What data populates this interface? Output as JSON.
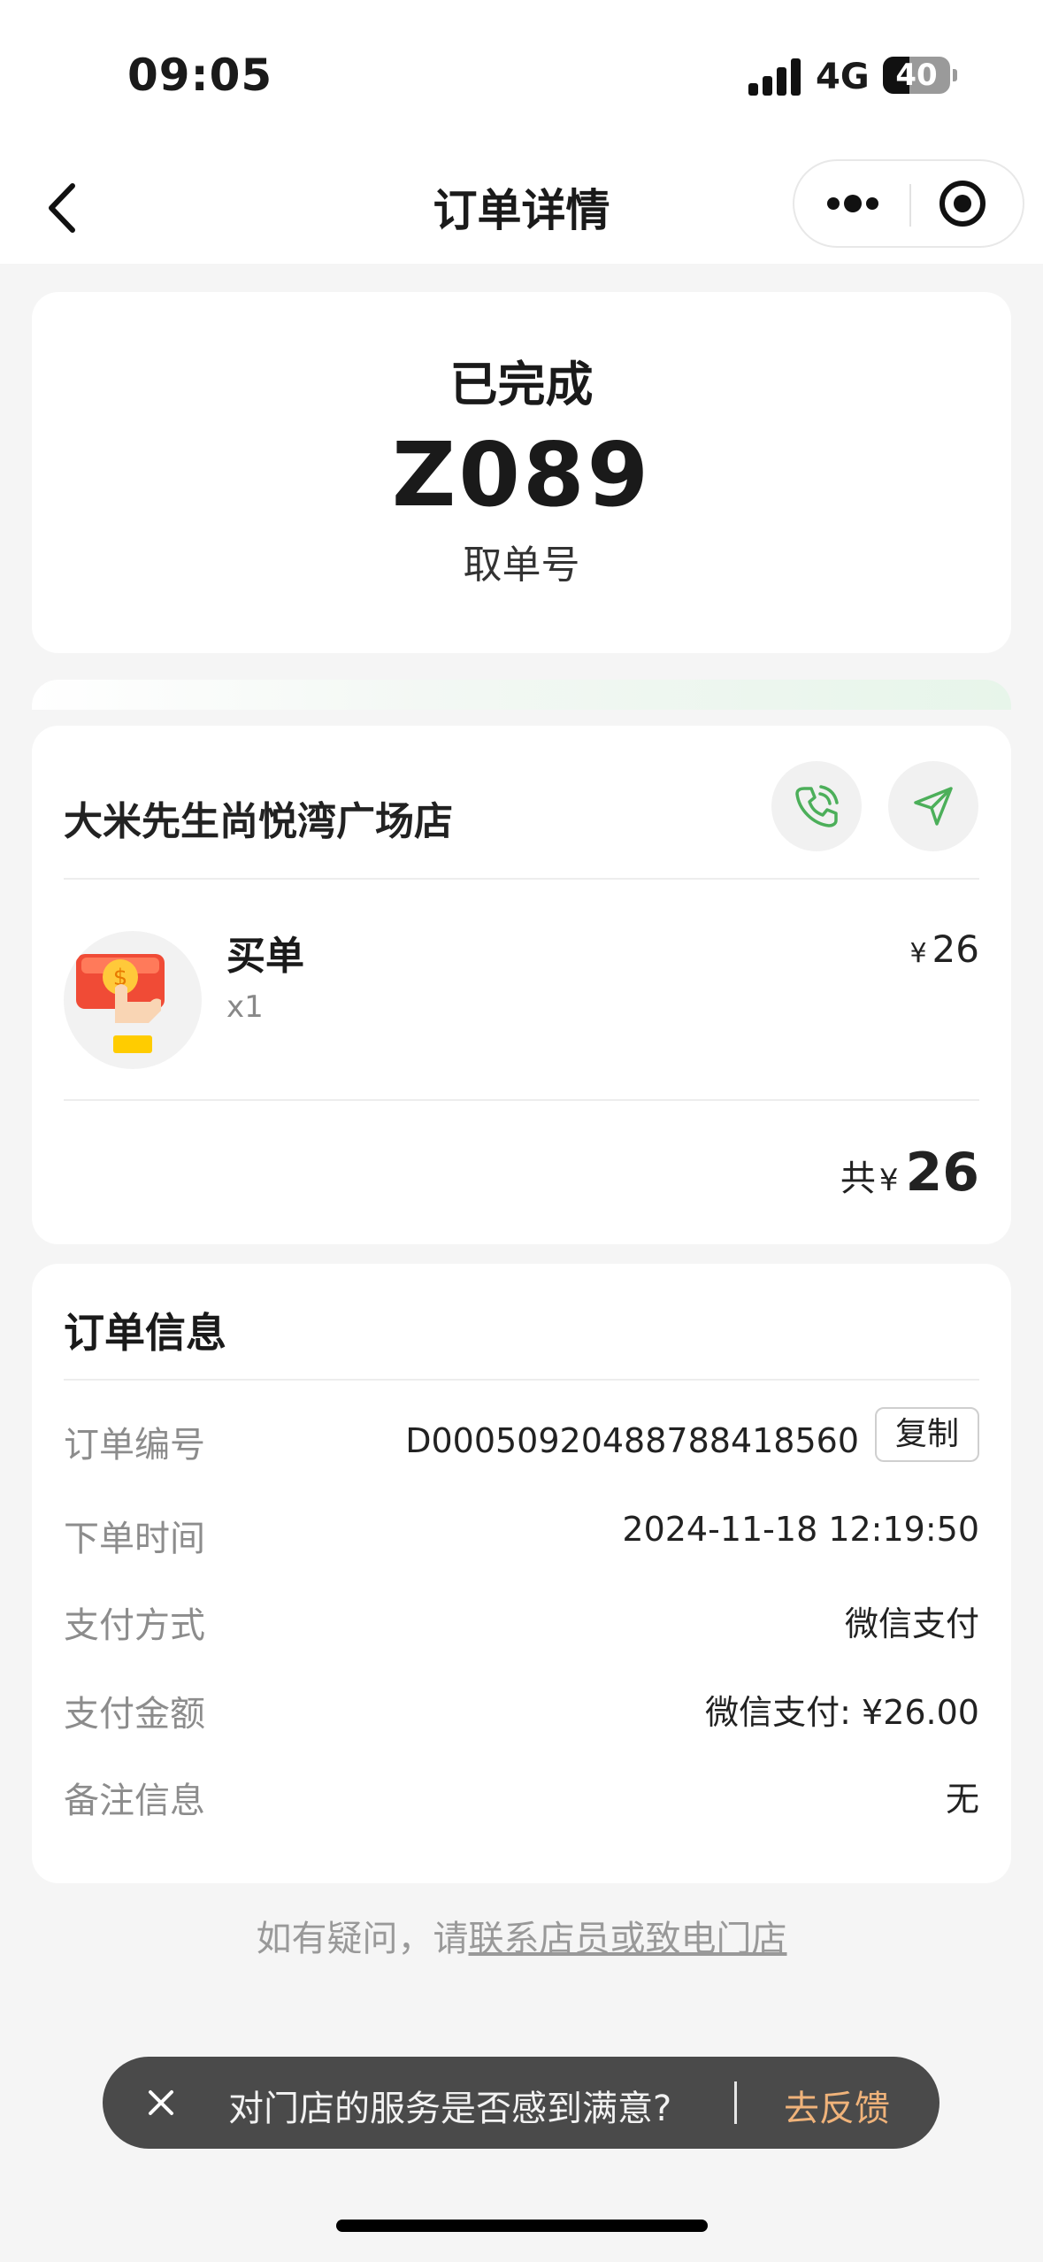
{
  "status_bar": {
    "time": "09:05",
    "network": "4G",
    "battery": "40",
    "battery_level": 0.4
  },
  "nav": {
    "title": "订单详情",
    "icons": [
      "chevron-left-icon",
      "more-dots-icon",
      "target-icon"
    ]
  },
  "order_status": {
    "status": "已完成",
    "pickup_code": "Z089",
    "pickup_label": "取单号"
  },
  "store": {
    "name": "大米先生尚悦湾广场店",
    "icons": [
      "phone-icon",
      "navigation-icon"
    ],
    "items": [
      {
        "name": "买单",
        "qty": "x1",
        "currency": "¥",
        "price": "26"
      }
    ],
    "total_label": "共",
    "total_currency": "¥",
    "total_amount": "26"
  },
  "order_info": {
    "title": "订单信息",
    "order_no_label": "订单编号",
    "order_no": "D00050920488788418560",
    "copy_label": "复制",
    "rows": [
      {
        "label": "下单时间",
        "value": "2024-11-18 12:19:50"
      },
      {
        "label": "支付方式",
        "value": "微信支付"
      },
      {
        "label": "支付金额",
        "value": "微信支付: ¥26.00"
      },
      {
        "label": "备注信息",
        "value": "无"
      }
    ]
  },
  "help": {
    "prefix": "如有疑问，请",
    "link": "联系店员或致电门店"
  },
  "feedback": {
    "question": "对门店的服务是否感到满意?",
    "action": "去反馈",
    "accent": "#f0b37a"
  },
  "colors": {
    "green_accent": "#4caf5a",
    "background": "#f5f5f5"
  }
}
